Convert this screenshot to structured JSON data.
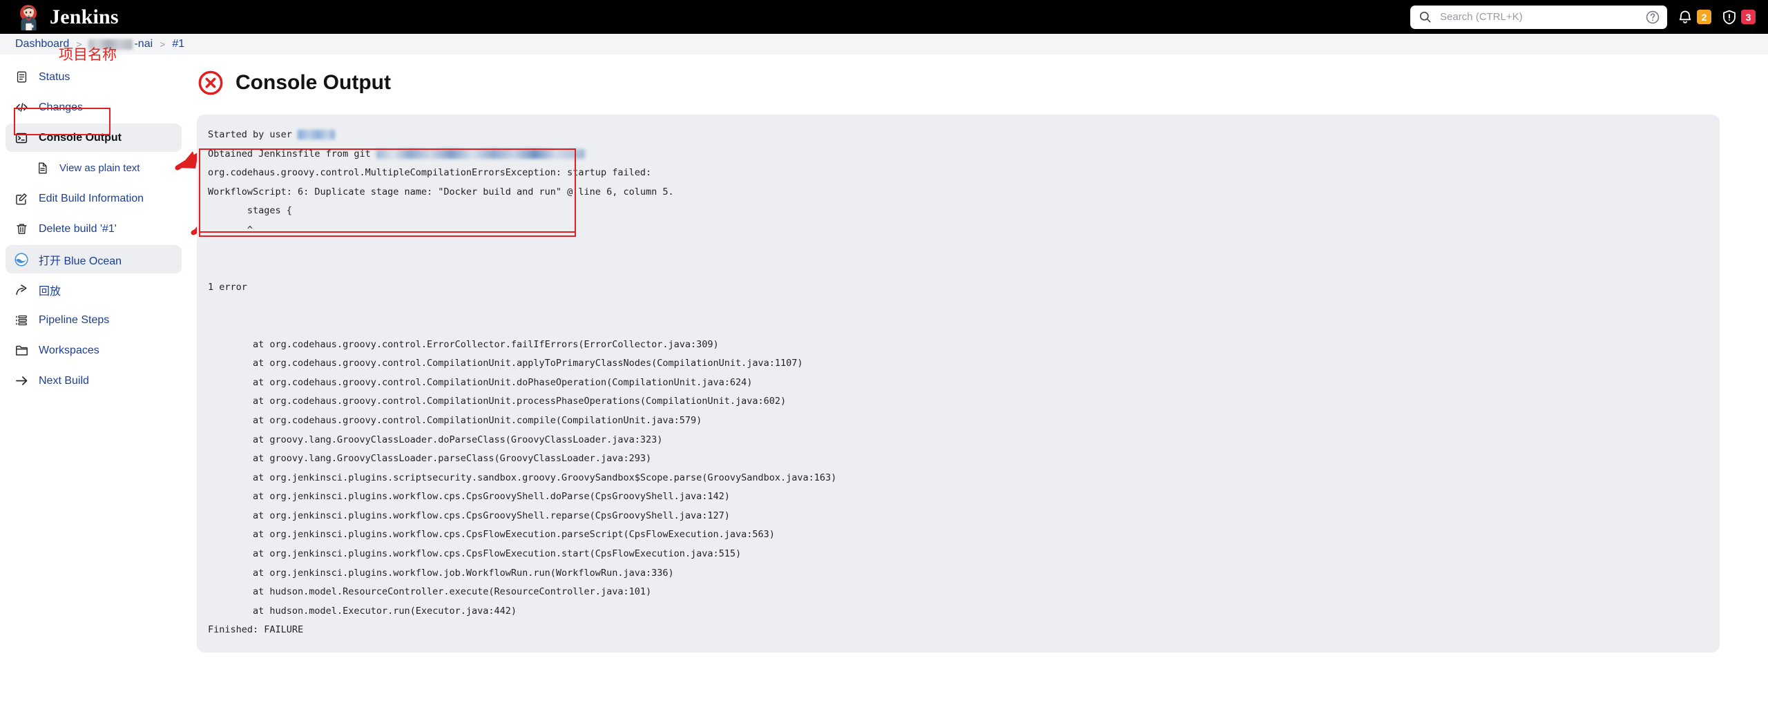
{
  "header": {
    "brand_name": "Jenkins",
    "logo_icon": "jenkins-butler-logo",
    "search": {
      "icon": "search-icon",
      "placeholder": "Search (CTRL+K)",
      "value": "",
      "help_icon": "question-circle-icon"
    },
    "notifications": {
      "icon": "bell-icon",
      "count": "2",
      "color": "#f5a623"
    },
    "security": {
      "icon": "shield-warning-icon",
      "count": "3",
      "color": "#e7324b"
    }
  },
  "breadcrumb": {
    "items": [
      {
        "label": "Dashboard",
        "blurred": false
      },
      {
        "label": "-nai",
        "blurred": true
      },
      {
        "label": "#1",
        "blurred": false
      }
    ],
    "separator": ">"
  },
  "annotations": {
    "project_name_note": "项目名称",
    "note_color": "#e8211c",
    "arrow_color": "#e02020",
    "highlight_color": "#e02020"
  },
  "sidebar": {
    "items": [
      {
        "label": "Status",
        "icon": "document-status-icon",
        "active": false,
        "sub": false
      },
      {
        "label": "Changes",
        "icon": "code-brackets-icon",
        "active": false,
        "sub": false
      },
      {
        "label": "Console Output",
        "icon": "terminal-icon",
        "active": true,
        "sub": false
      },
      {
        "label": "View as plain text",
        "icon": "plain-text-file-icon",
        "active": false,
        "sub": true
      },
      {
        "label": "Edit Build Information",
        "icon": "edit-pencil-square-icon",
        "active": false,
        "sub": false
      },
      {
        "label": "Delete build '#1'",
        "icon": "trash-can-icon",
        "active": false,
        "sub": false
      },
      {
        "label": "打开 Blue Ocean",
        "icon": "blue-ocean-icon",
        "active": false,
        "sub": false
      },
      {
        "label": "回放",
        "icon": "replay-arrow-icon",
        "active": false,
        "sub": false
      },
      {
        "label": "Pipeline Steps",
        "icon": "pipeline-steps-list-icon",
        "active": false,
        "sub": false
      },
      {
        "label": "Workspaces",
        "icon": "folder-icon",
        "active": false,
        "sub": false
      },
      {
        "label": "Next Build",
        "icon": "arrow-right-icon",
        "active": false,
        "sub": false
      }
    ]
  },
  "main": {
    "title": "Console Output",
    "status_icon": "error-circle-x-icon",
    "status_color": "#e02020",
    "console_lines": {
      "line_started_prefix": "Started by user ",
      "line_jenkinsfile_prefix": "Obtained Jenkinsfile from git ",
      "rest": "org.codehaus.groovy.control.MultipleCompilationErrorsException: startup failed:\nWorkflowScript: 6: Duplicate stage name: \"Docker build and run\" @ line 6, column 5.\n       stages {\n       ^\n\n\n1 error\n\n\n        at org.codehaus.groovy.control.ErrorCollector.failIfErrors(ErrorCollector.java:309)\n        at org.codehaus.groovy.control.CompilationUnit.applyToPrimaryClassNodes(CompilationUnit.java:1107)\n        at org.codehaus.groovy.control.CompilationUnit.doPhaseOperation(CompilationUnit.java:624)\n        at org.codehaus.groovy.control.CompilationUnit.processPhaseOperations(CompilationUnit.java:602)\n        at org.codehaus.groovy.control.CompilationUnit.compile(CompilationUnit.java:579)\n        at groovy.lang.GroovyClassLoader.doParseClass(GroovyClassLoader.java:323)\n        at groovy.lang.GroovyClassLoader.parseClass(GroovyClassLoader.java:293)\n        at org.jenkinsci.plugins.scriptsecurity.sandbox.groovy.GroovySandbox$Scope.parse(GroovySandbox.java:163)\n        at org.jenkinsci.plugins.workflow.cps.CpsGroovyShell.doParse(CpsGroovyShell.java:142)\n        at org.jenkinsci.plugins.workflow.cps.CpsGroovyShell.reparse(CpsGroovyShell.java:127)\n        at org.jenkinsci.plugins.workflow.cps.CpsFlowExecution.parseScript(CpsFlowExecution.java:563)\n        at org.jenkinsci.plugins.workflow.cps.CpsFlowExecution.start(CpsFlowExecution.java:515)\n        at org.jenkinsci.plugins.workflow.job.WorkflowRun.run(WorkflowRun.java:336)\n        at hudson.model.ResourceController.execute(ResourceController.java:101)\n        at hudson.model.Executor.run(Executor.java:442)\nFinished: FAILURE"
    }
  }
}
